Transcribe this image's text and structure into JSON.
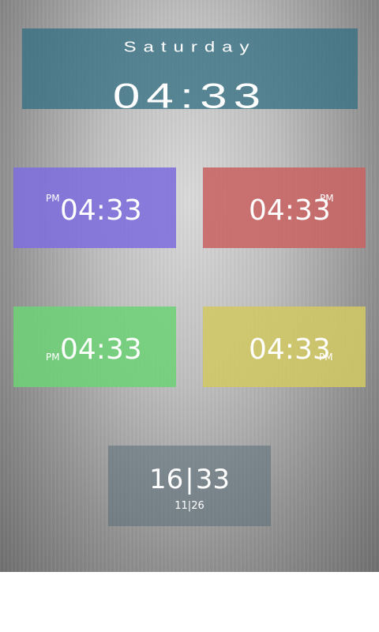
{
  "colors": {
    "big_clock_bg": "#326e82",
    "purple": "#7d6edc",
    "red": "#c86464",
    "green": "#6ed278",
    "yellow": "#d2c864"
  },
  "big_clock": {
    "day": "Saturday",
    "time": "04:33"
  },
  "tiles": [
    {
      "time": "04:33",
      "ampm": "PM"
    },
    {
      "time": "04:33",
      "ampm": "PM"
    },
    {
      "time": "04:33",
      "ampm": "PM"
    },
    {
      "time": "04:33",
      "ampm": "PM"
    }
  ],
  "digital": {
    "hour": "16",
    "minute": "33",
    "month": "11",
    "day": "26",
    "separator": "|"
  }
}
